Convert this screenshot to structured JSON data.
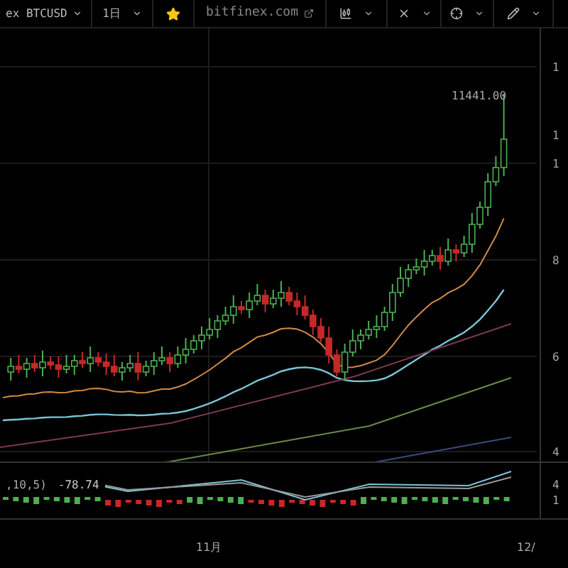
{
  "toolbar": {
    "symbol": "ex BTCUSD",
    "interval": "1日",
    "site": "bitfinex.com"
  },
  "chart": {
    "last_high_label": "11441.00",
    "price_axis": [
      "1",
      "1",
      "1",
      "8",
      "6",
      "4"
    ]
  },
  "indicator": {
    "label": ",10,5)",
    "value": "-78.74",
    "axis": [
      "4",
      "1"
    ]
  },
  "time_axis": [
    "11月",
    "12/"
  ]
}
